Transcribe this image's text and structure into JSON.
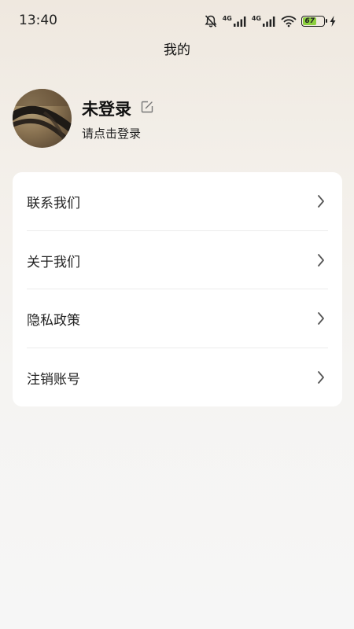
{
  "status_bar": {
    "time": "13:40",
    "network_1": "4G",
    "network_2": "4G",
    "battery_percent": "67",
    "icons": [
      "bell-muted-icon",
      "signal-icon",
      "signal-icon",
      "wifi-icon",
      "battery-icon",
      "charging-icon"
    ]
  },
  "header": {
    "title": "我的"
  },
  "profile": {
    "name": "未登录",
    "subtitle": "请点击登录"
  },
  "menu": {
    "items": [
      {
        "label": "联系我们"
      },
      {
        "label": "关于我们"
      },
      {
        "label": "隐私政策"
      },
      {
        "label": "注销账号"
      }
    ]
  },
  "colors": {
    "battery_fill": "#8ccf3e",
    "card_bg": "#ffffff",
    "page_bg_top": "#efe8df",
    "page_bg_bottom": "#f6f6f6"
  }
}
